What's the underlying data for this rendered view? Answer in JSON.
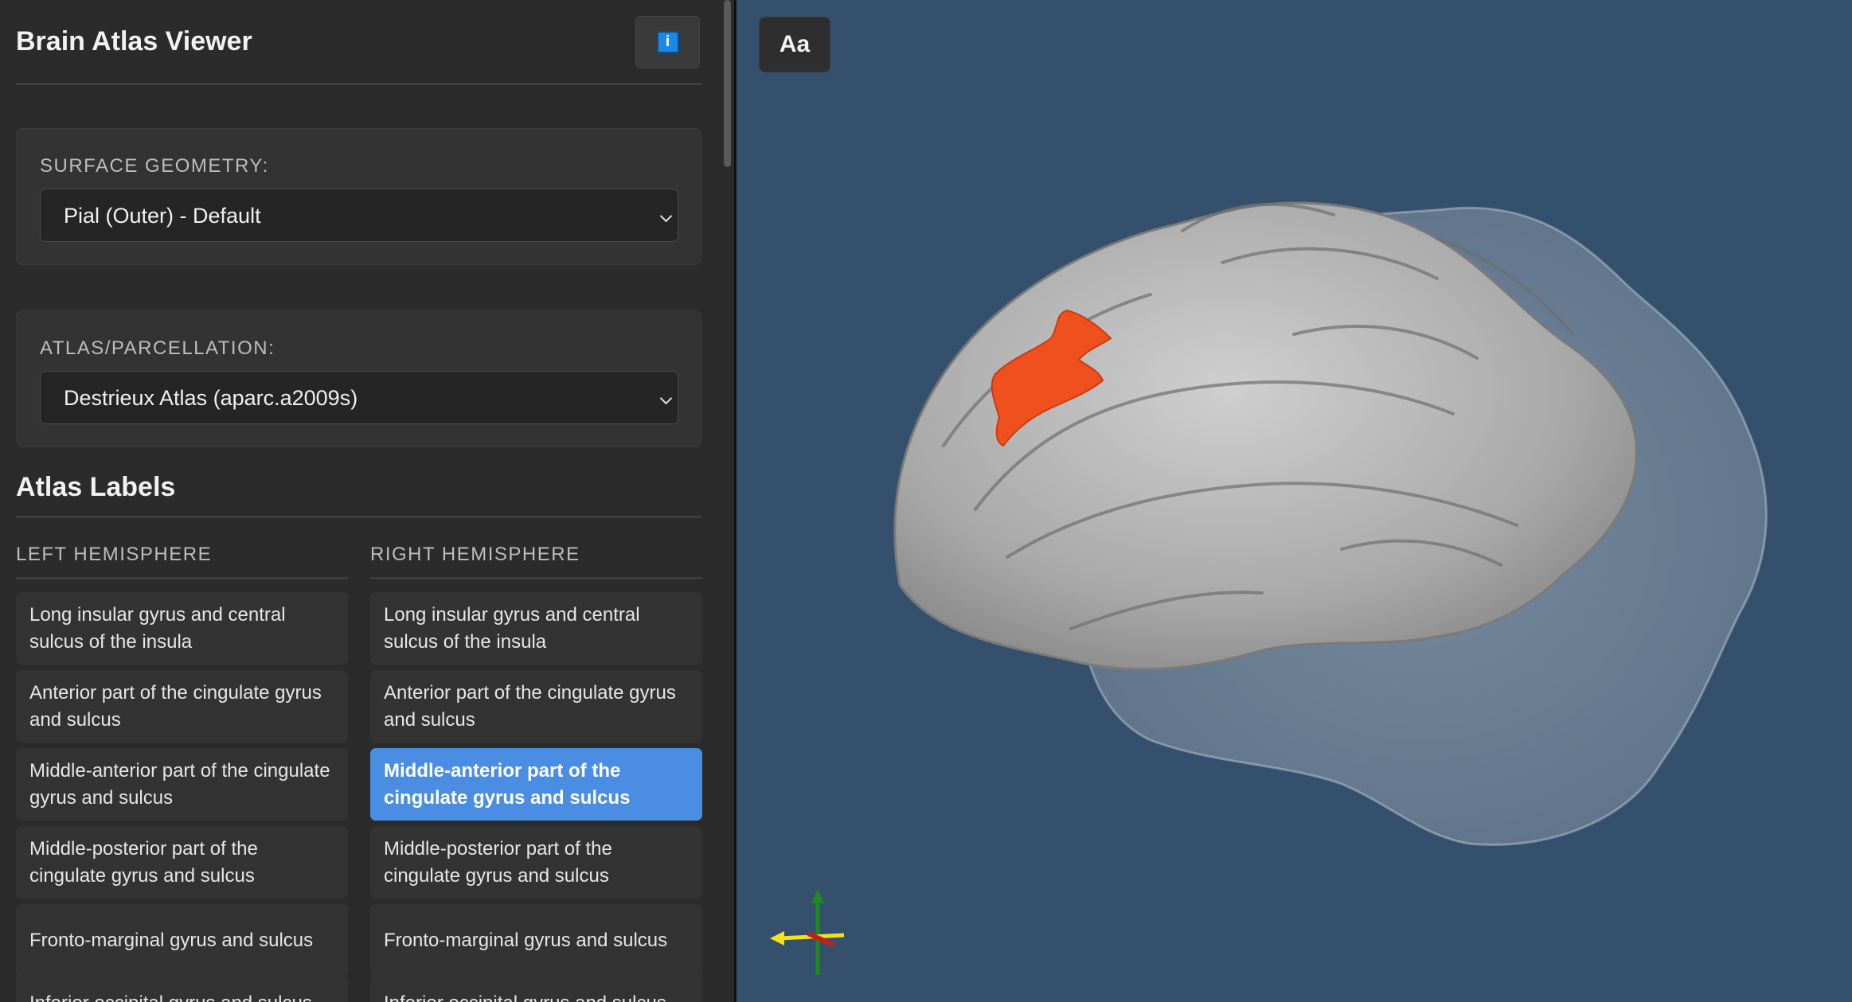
{
  "app": {
    "title": "Brain Atlas Viewer",
    "info_icon": "info-icon",
    "info_glyph": "i"
  },
  "surface": {
    "label": "SURFACE GEOMETRY:",
    "selected": "Pial (Outer) - Default"
  },
  "atlas": {
    "label": "ATLAS/PARCELLATION:",
    "selected": "Destrieux Atlas (aparc.a2009s)"
  },
  "labels_section": {
    "title": "Atlas Labels",
    "left_header": "LEFT HEMISPHERE",
    "right_header": "RIGHT HEMISPHERE",
    "left_items": [
      "Long insular gyrus and central sulcus of the insula",
      "Anterior part of the cingulate gyrus and sulcus",
      "Middle-anterior part of the cingulate gyrus and sulcus",
      "Middle-posterior part of the cingulate gyrus and sulcus",
      "Fronto-marginal gyrus and sulcus",
      "Inferior occipital gyrus and sulcus"
    ],
    "right_items": [
      "Long insular gyrus and central sulcus of the insula",
      "Anterior part of the cingulate gyrus and sulcus",
      "Middle-anterior part of the cingulate gyrus and sulcus",
      "Middle-posterior part of the cingulate gyrus and sulcus",
      "Fronto-marginal gyrus and sulcus",
      "Inferior occipital gyrus and sulcus"
    ],
    "selected": "right-2"
  },
  "viewer": {
    "font_button": "Aa",
    "background": "#34506d",
    "highlight_color": "#f0501e",
    "axes": [
      "x-axis-red",
      "y-axis-green",
      "z-axis-yellow"
    ]
  }
}
